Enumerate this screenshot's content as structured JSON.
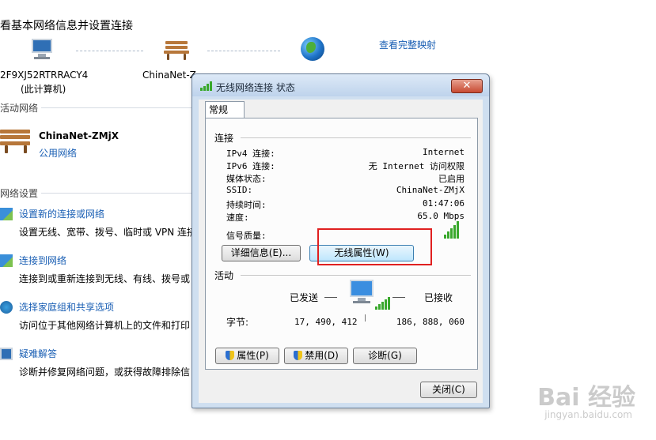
{
  "background": {
    "header_title": "看基本网络信息并设置连接",
    "map_link": "查看完整映射",
    "computer_name": "2F9XJ52RTRRACY4",
    "computer_sub": "(此计算机)",
    "network_name_short": "ChinaNet-Z",
    "active_networks_label": "活动网络",
    "network_name": "ChinaNet-ZMjX",
    "network_type": "公用网络",
    "change_settings_label": "网络设置",
    "tasks": [
      {
        "title": "设置新的连接或网络",
        "desc": "设置无线、宽带、拨号、临时或 VPN 连接"
      },
      {
        "title": "连接到网络",
        "desc": "连接到或重新连接到无线、有线、拨号或"
      },
      {
        "title": "选择家庭组和共享选项",
        "desc": "访问位于其他网络计算机上的文件和打印"
      },
      {
        "title": "疑难解答",
        "desc": "诊断并修复网络问题，或获得故障排除信"
      }
    ]
  },
  "dialog": {
    "title": "无线网络连接 状态",
    "close_glyph": "✕",
    "tab": "常规",
    "connection_group": "连接",
    "rows": [
      {
        "label": "IPv4 连接:",
        "value": "Internet"
      },
      {
        "label": "IPv6 连接:",
        "value": "无 Internet 访问权限"
      },
      {
        "label": "媒体状态:",
        "value": "已启用"
      },
      {
        "label": "SSID:",
        "value": "ChinaNet-ZMjX"
      },
      {
        "label": "持续时间:",
        "value": "01:47:06"
      },
      {
        "label": "速度:",
        "value": "65.0 Mbps"
      }
    ],
    "signal_label": "信号质量:",
    "signal_level": "5/5",
    "details_button": "详细信息(E)...",
    "wireless_props_button": "无线属性(W)",
    "activity_group": "活动",
    "sent_label": "已发送",
    "received_label": "已接收",
    "bytes_label": "字节:",
    "bytes_sent": "17, 490, 412",
    "bytes_received": "186, 888, 060",
    "properties_button": "属性(P)",
    "disable_button": "禁用(D)",
    "diagnose_button": "诊断(G)",
    "close_button": "关闭(C)"
  },
  "watermark": {
    "brand": "Bai 经验",
    "url": "jingyan.baidu.com"
  },
  "colors": {
    "link": "#1a5fb4",
    "highlight_box": "#e02020",
    "signal": "#39a82c"
  }
}
